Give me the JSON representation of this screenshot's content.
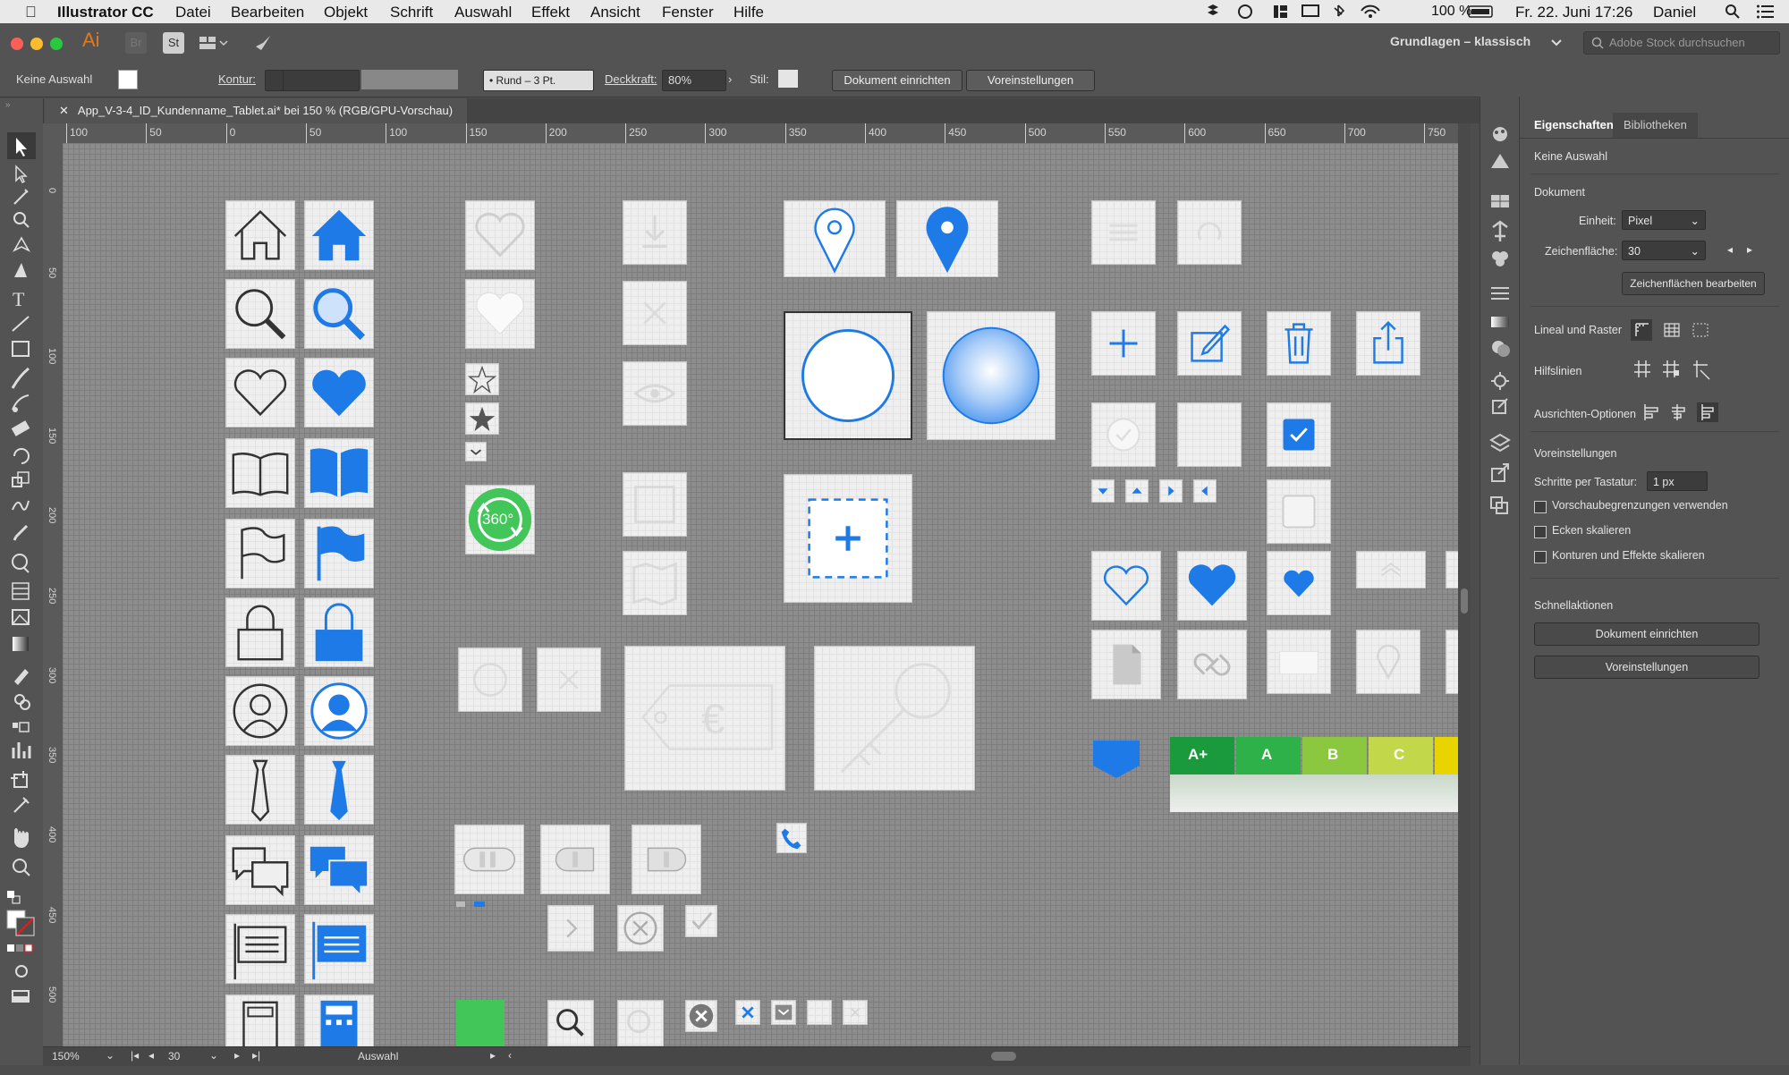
{
  "menubar": {
    "app_name": "Illustrator CC",
    "items": [
      "Datei",
      "Bearbeiten",
      "Objekt",
      "Schrift",
      "Auswahl",
      "Effekt",
      "Ansicht",
      "Fenster",
      "Hilfe"
    ],
    "battery": "100 %",
    "datetime": "Fr. 22. Juni 17:26",
    "user": "Daniel"
  },
  "appbar": {
    "app_logo": "Ai",
    "bridge": "Br",
    "stock": "St",
    "workspace": "Grundlagen – klassisch",
    "search_placeholder": "Adobe Stock durchsuchen"
  },
  "control": {
    "selection": "Keine Auswahl",
    "stroke_label": "Kontur:",
    "brush": "Rund – 3 Pt.",
    "opacity_label": "Deckkraft:",
    "opacity_value": "80%",
    "style_label": "Stil:",
    "doc_setup": "Dokument einrichten",
    "preferences": "Voreinstellungen"
  },
  "document": {
    "tab_title": "App_V-3-4_ID_Kundenname_Tablet.ai* bei 150 % (RGB/GPU-Vorschau)"
  },
  "ruler": {
    "h_ticks": [
      "100",
      "50",
      "0",
      "50",
      "100",
      "150",
      "200",
      "250",
      "300",
      "350",
      "400",
      "450",
      "500",
      "550",
      "600",
      "650",
      "700",
      "750"
    ],
    "v_ticks": [
      "0",
      "50",
      "100",
      "150",
      "200",
      "250",
      "300",
      "350",
      "400",
      "450",
      "500"
    ]
  },
  "canvas": {
    "energy_labels": [
      "A+",
      "A",
      "B",
      "C"
    ],
    "badge_360": "360°",
    "energy_colors": [
      "#1a9a3c",
      "#2fb14a",
      "#8bc83f",
      "#c2d84a",
      "#e7d400"
    ],
    "accent_blue": "#1e7ae6",
    "green": "#42c65a"
  },
  "statusbar": {
    "zoom": "150%",
    "artboard": "30",
    "mode": "Auswahl"
  },
  "properties": {
    "tab_active": "Eigenschaften",
    "tab_other": "Bibliotheken",
    "selection": "Keine Auswahl",
    "document_heading": "Dokument",
    "unit_label": "Einheit:",
    "unit_value": "Pixel",
    "artboard_label": "Zeichenfläche:",
    "artboard_value": "30",
    "edit_artboards": "Zeichenflächen bearbeiten",
    "rulers_grid": "Lineal und Raster",
    "guides": "Hilfslinien",
    "align_options": "Ausrichten-Optionen",
    "preferences_heading": "Voreinstellungen",
    "keyboard_increment_label": "Schritte per Tastatur:",
    "keyboard_increment_value": "1 px",
    "cb_preview_bounds": "Vorschaubegrenzungen verwenden",
    "cb_scale_corners": "Ecken skalieren",
    "cb_scale_strokes": "Konturen und Effekte skalieren",
    "quick_actions": "Schnellaktionen",
    "qa_doc_setup": "Dokument einrichten",
    "qa_preferences": "Voreinstellungen"
  }
}
